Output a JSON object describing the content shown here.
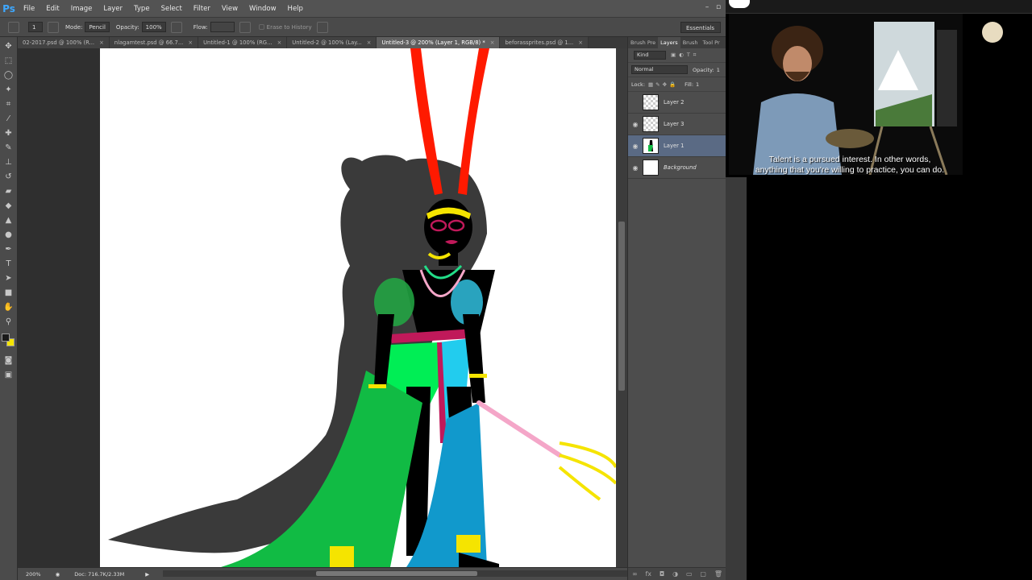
{
  "app": {
    "logo": "Ps",
    "menu": [
      "File",
      "Edit",
      "Image",
      "Layer",
      "Type",
      "Select",
      "Filter",
      "View",
      "Window",
      "Help"
    ]
  },
  "options_bar": {
    "size_value": "1",
    "mode_label": "Mode:",
    "mode_value": "Pencil",
    "opacity_label": "Opacity:",
    "opacity_value": "100%",
    "flow_label": "Flow:",
    "erase_history_label": "Erase to History",
    "workspace_value": "Essentials"
  },
  "tabs": [
    {
      "label": "02-2017.psd @ 100% (R...",
      "active": false
    },
    {
      "label": "nlagamtest.psd @ 66.7...",
      "active": false
    },
    {
      "label": "Untitled-1 @ 100% (RG...",
      "active": false
    },
    {
      "label": "Untitled-2 @ 100% (Lay...",
      "active": false
    },
    {
      "label": "Untitled-3 @ 200% (Layer 1, RGB/8) *",
      "active": true
    },
    {
      "label": "beforassprites.psd @ 1...",
      "active": false
    }
  ],
  "status": {
    "zoom": "200%",
    "doc": "Doc: 716.7K/2.33M"
  },
  "right_panel": {
    "tabs": [
      "Brush Pre",
      "Layers",
      "Brush",
      "Tool Pr"
    ],
    "active_tab": "Layers",
    "filter_value": "Kind",
    "blend_mode": "Normal",
    "opacity_label": "Opacity:",
    "opacity_value": "1",
    "lock_label": "Lock:",
    "fill_label": "Fill:",
    "fill_value": "1",
    "layers": [
      {
        "name": "Layer 2",
        "visible": false,
        "selected": false,
        "thumb": "transparent"
      },
      {
        "name": "Layer 3",
        "visible": true,
        "selected": false,
        "thumb": "transparent"
      },
      {
        "name": "Layer 1",
        "visible": true,
        "selected": true,
        "thumb": "figure"
      },
      {
        "name": "Background",
        "visible": true,
        "selected": false,
        "thumb": "white"
      }
    ]
  },
  "video": {
    "subtitle_line1": "Talent is a pursued interest. In other words,",
    "subtitle_line2": "anything that you're willing to practice, you can do."
  },
  "colors": {
    "foreground": "#1a1a1a",
    "background": "#f5e400",
    "ps_blue": "#3ea8ff",
    "selected_layer": "#5a6a84"
  }
}
